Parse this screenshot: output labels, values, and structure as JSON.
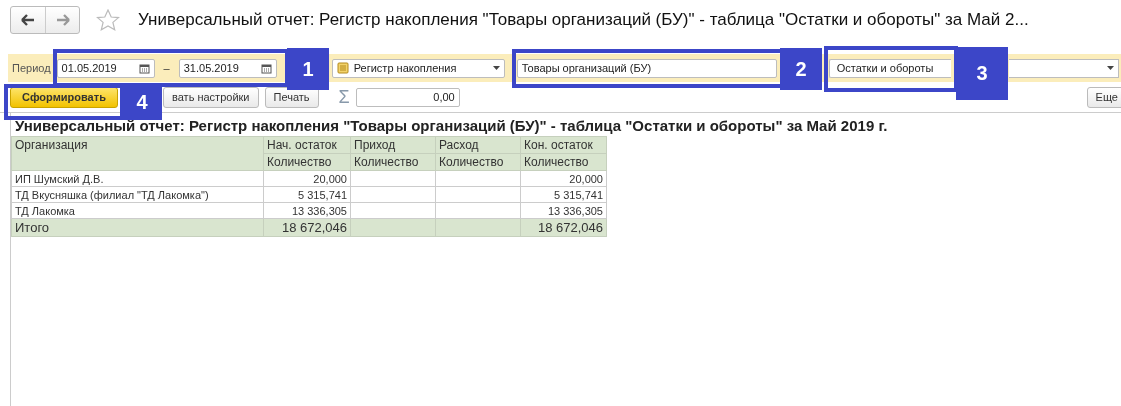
{
  "window": {
    "title": "Универсальный отчет: Регистр накопления \"Товары организаций (БУ)\" - таблица \"Остатки и обороты\" за Май 2..."
  },
  "filters": {
    "period_label": "Период",
    "date_from": "01.05.2019",
    "separator": "–",
    "date_to": "31.05.2019",
    "source_type": "Регистр накопления",
    "source": "Товары организаций (БУ)",
    "table": "Остатки и обороты"
  },
  "actions": [
    {
      "label": "Сформировать",
      "kind": "primary"
    },
    {
      "label": "вать настройки",
      "kind": "normal"
    },
    {
      "label": "Печать",
      "kind": "normal"
    }
  ],
  "sum": {
    "symbol": "Σ",
    "value": "0,00"
  },
  "more_button": "Еще",
  "report": {
    "title": "Универсальный отчет: Регистр накопления \"Товары организаций (БУ)\" - таблица \"Остатки и обороты\" за Май 2019 г.",
    "columns": [
      {
        "label": "Организация"
      },
      {
        "label": "Нач. остаток",
        "unit": "Количество"
      },
      {
        "label": "Приход",
        "unit": "Количество"
      },
      {
        "label": "Расход",
        "unit": "Количество"
      },
      {
        "label": "Кон. остаток",
        "unit": "Количество"
      }
    ],
    "rows": [
      {
        "name": "ИП Шумский Д.В.",
        "opening": "20,000",
        "closing": "20,000"
      },
      {
        "name": "ТД Вкусняшка (филиал \"ТД Лакомка\")",
        "opening": "5 315,741",
        "closing": "5 315,741"
      },
      {
        "name": "ТД Лакомка",
        "opening": "13 336,305",
        "closing": "13 336,305"
      }
    ],
    "total": {
      "label": "Итого",
      "opening": "18 672,046",
      "closing": "18 672,046"
    }
  },
  "callouts": [
    {
      "number": "1"
    },
    {
      "number": "2"
    },
    {
      "number": "3"
    },
    {
      "number": "4"
    }
  ]
}
